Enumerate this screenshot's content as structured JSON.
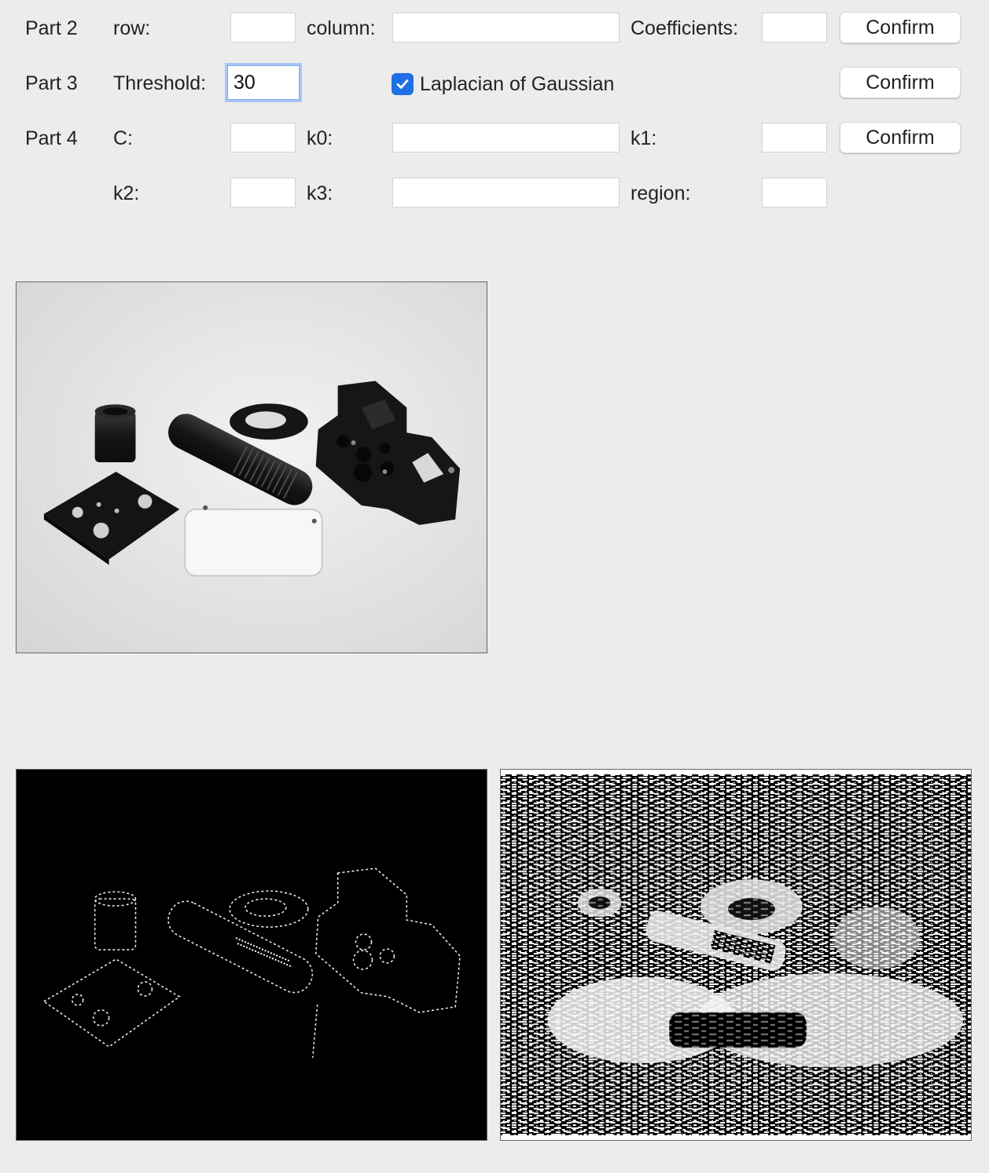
{
  "part2": {
    "label": "Part 2",
    "row_label": "row:",
    "row_value": "",
    "column_label": "column:",
    "column_value": "",
    "coefficients_label": "Coefficients:",
    "coefficients_value": "",
    "confirm_label": "Confirm"
  },
  "part3": {
    "label": "Part 3",
    "threshold_label": "Threshold:",
    "threshold_value": "30",
    "log_checkbox_label": "Laplacian of Gaussian",
    "log_checked": true,
    "confirm_label": "Confirm"
  },
  "part4": {
    "label": "Part 4",
    "c_label": "C:",
    "c_value": "",
    "k0_label": "k0:",
    "k0_value": "",
    "k1_label": "k1:",
    "k1_value": "",
    "confirm_label": "Confirm",
    "k2_label": "k2:",
    "k2_value": "",
    "k3_label": "k3:",
    "k3_value": "",
    "region_label": "region:",
    "region_value": ""
  },
  "images": {
    "original": "grayscale photo of machined parts",
    "edges_threshold": "edge detection result (sparse edges on black)",
    "edges_log": "Laplacian of Gaussian result (noisy black and white)"
  },
  "colors": {
    "window_bg": "#ececec",
    "accent": "#1f6fe5",
    "focus_ring": "#a9c6f5"
  },
  "icons": {
    "checkbox": "checkmark-icon"
  }
}
